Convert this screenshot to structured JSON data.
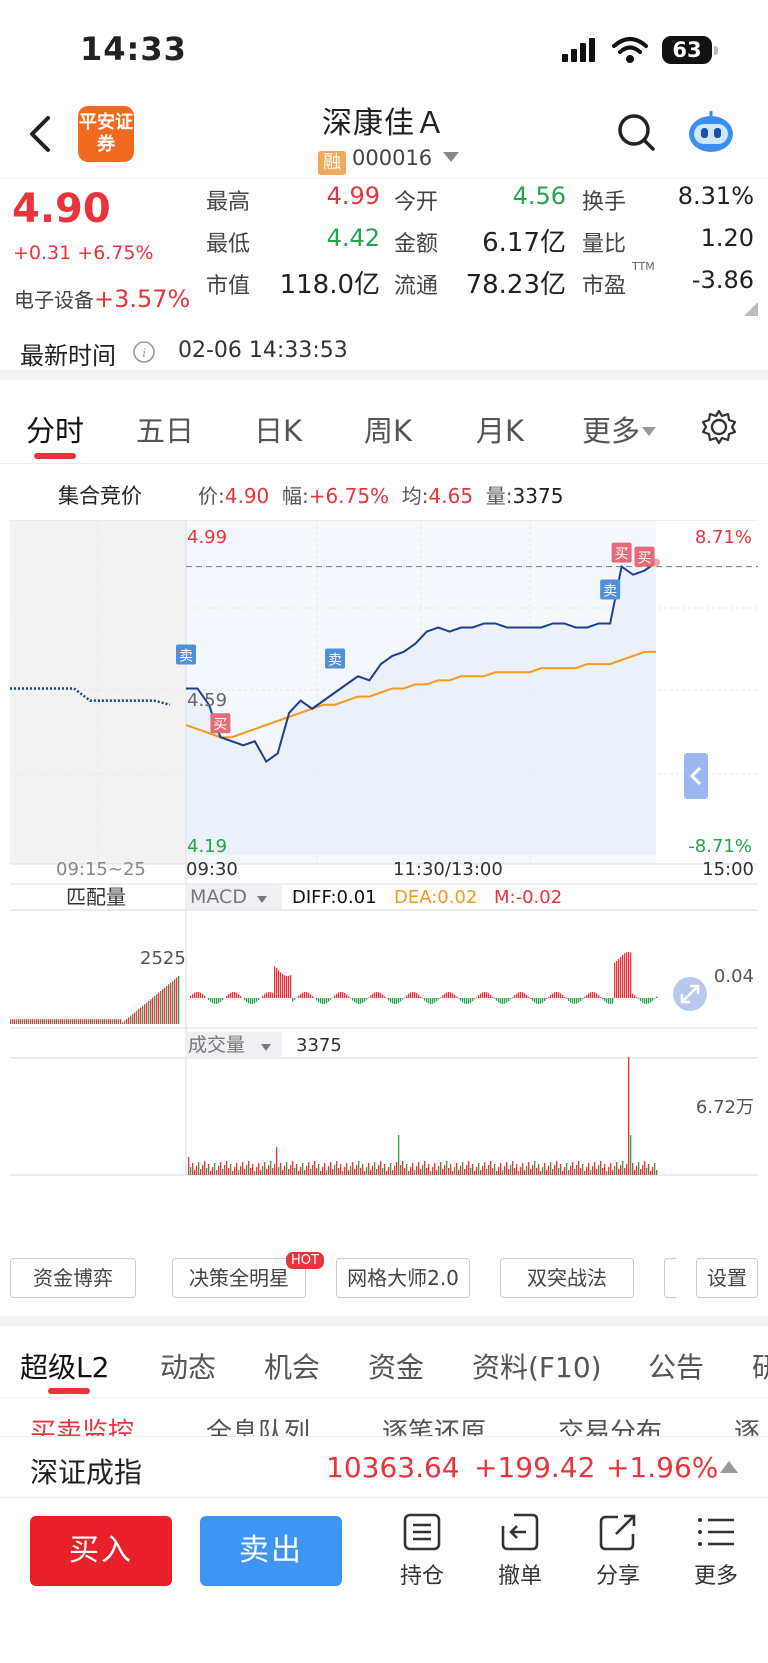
{
  "status": {
    "time": "14:33",
    "battery": "63"
  },
  "header": {
    "stock_name": "深康佳Ａ",
    "rong_badge": "融",
    "code": "000016",
    "logo_text": "平安证券"
  },
  "quote": {
    "price": "4.90",
    "change": "+0.31",
    "change_pct": "+6.75%",
    "sector": "电子设备",
    "sector_pct": "+3.57%",
    "high_label": "最高",
    "high": "4.99",
    "low_label": "最低",
    "low": "4.42",
    "mktcap_label": "市值",
    "mktcap": "118.0亿",
    "open_label": "今开",
    "open": "4.56",
    "amount_label": "金额",
    "amount": "6.17亿",
    "float_label": "流通",
    "float_cap": "78.23亿",
    "turnover_label": "换手",
    "turnover": "8.31%",
    "vol_ratio_label": "量比",
    "vol_ratio": "1.20",
    "pe_label": "市盈",
    "pe_sup": "TTM",
    "pe": "-3.86"
  },
  "update": {
    "label": "最新时间",
    "time": "02-06 14:33:53"
  },
  "ktabs": [
    "分时",
    "五日",
    "日K",
    "周K",
    "月K",
    "更多"
  ],
  "infobar": {
    "auction": "集合竞价",
    "price_label": "价:",
    "price": "4.90",
    "amp_label": "幅:",
    "amp": "+6.75%",
    "avg_label": "均:",
    "avg": "4.65",
    "vol_label": "量:",
    "vol": "3375"
  },
  "chart_data": {
    "type": "line",
    "title": "",
    "y_top": "4.99",
    "y_mid": "4.59",
    "y_bottom": "4.19",
    "pct_top": "8.71%",
    "pct_bottom": "-8.71%",
    "x_labels": [
      "09:15~25",
      "09:30",
      "11:30/13:00",
      "15:00"
    ],
    "ylim": [
      4.19,
      4.99
    ],
    "series": [],
    "price": [
      4.6,
      4.6,
      4.56,
      4.48,
      4.47,
      4.46,
      4.47,
      4.42,
      4.44,
      4.54,
      4.57,
      4.55,
      4.57,
      4.59,
      4.61,
      4.63,
      4.62,
      4.66,
      4.68,
      4.69,
      4.71,
      4.74,
      4.75,
      4.74,
      4.75,
      4.75,
      4.76,
      4.76,
      4.75,
      4.75,
      4.75,
      4.75,
      4.76,
      4.76,
      4.75,
      4.75,
      4.76,
      4.76,
      4.9,
      4.88,
      4.89,
      4.91
    ],
    "avg": [
      4.51,
      4.5,
      4.49,
      4.48,
      4.48,
      4.49,
      4.5,
      4.51,
      4.52,
      4.53,
      4.54,
      4.55,
      4.56,
      4.56,
      4.57,
      4.58,
      4.58,
      4.59,
      4.6,
      4.6,
      4.61,
      4.61,
      4.62,
      4.62,
      4.63,
      4.63,
      4.63,
      4.64,
      4.64,
      4.64,
      4.64,
      4.65,
      4.65,
      4.65,
      4.65,
      4.66,
      4.66,
      4.66,
      4.67,
      4.68,
      4.69,
      4.69
    ],
    "pre_price": [
      4.6,
      4.6,
      4.6,
      4.6,
      4.6,
      4.57,
      4.57,
      4.57,
      4.57,
      4.57,
      4.56
    ],
    "markers": [
      {
        "text": "卖",
        "kind": "sell"
      },
      {
        "text": "买",
        "kind": "buy"
      },
      {
        "text": "卖",
        "kind": "sell"
      },
      {
        "text": "卖",
        "kind": "sell"
      },
      {
        "text": "买",
        "kind": "buy"
      },
      {
        "text": "买",
        "kind": "buy"
      }
    ],
    "match_label": "匹配量",
    "match_value": "2525",
    "macd": {
      "label": "MACD",
      "diff_label": "DIFF:",
      "diff": "0.01",
      "dea_label": "DEA:",
      "dea": "0.02",
      "m_label": "M:",
      "m": "-0.02",
      "right_value": "0.04"
    },
    "volume": {
      "label": "成交量",
      "value": "3375",
      "max_label": "6.72万"
    }
  },
  "features": [
    "资金博弈",
    "决策全明星",
    "网格大师2.0",
    "双突战法",
    "设置"
  ],
  "hot": "HOT",
  "l2tabs": [
    "超级L2",
    "动态",
    "机会",
    "资金",
    "资料(F10)",
    "公告",
    "研"
  ],
  "subtabs": [
    "买卖监控",
    "全息队列",
    "逐笔还原",
    "交易分布",
    "逐"
  ],
  "index": {
    "name": "深证成指",
    "value": "10363.64",
    "change": "+199.42",
    "pct": "+1.96%"
  },
  "bottom": {
    "buy": "买入",
    "sell": "卖出",
    "tools": [
      "持仓",
      "撤单",
      "分享",
      "更多"
    ]
  },
  "colors": {
    "up": "#e8343c",
    "down": "#21a64b",
    "price_line": "#1d3f8f",
    "avg_line": "#f39a1f",
    "sell_btn": "#3f96f2"
  }
}
